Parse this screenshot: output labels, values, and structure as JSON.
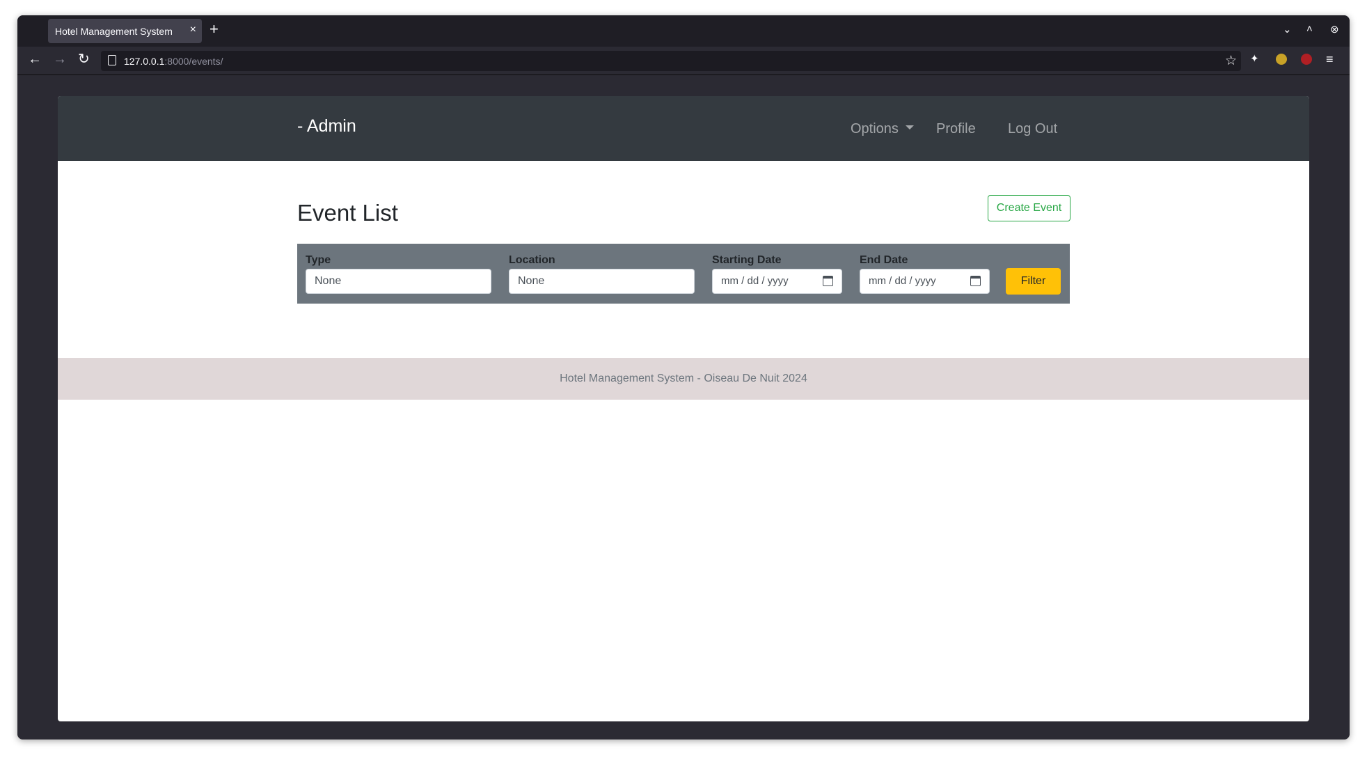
{
  "browser": {
    "tab_title": "Hotel Management System",
    "tab_close": "×",
    "new_tab": "+",
    "url_host": "127.0.0.1",
    "url_rest": ":8000/events/",
    "controls": {
      "list_all_tabs": "⌄",
      "maximize": "˄",
      "close": "⊗"
    }
  },
  "navbar": {
    "brand": "- Admin",
    "links": [
      {
        "label": "Options"
      },
      {
        "label": "Profile"
      },
      {
        "label": "Log Out"
      }
    ]
  },
  "main": {
    "title": "Event List",
    "create_button": "Create Event"
  },
  "filter": {
    "fields": [
      {
        "label": "Type",
        "value": "None"
      },
      {
        "label": "Location",
        "value": "None"
      },
      {
        "label": "Starting Date",
        "placeholder": "mm / dd / yyyy"
      },
      {
        "label": "End Date",
        "placeholder": "mm / dd / yyyy"
      }
    ],
    "button": "Filter"
  },
  "footer": {
    "text": "Hotel Management System - Oiseau De Nuit 2024"
  },
  "colors": {
    "navbar_bg": "#343a40",
    "filter_bg": "#6c757d",
    "filter_button": "#ffc107",
    "create_button": "#28a745",
    "footer_bg": "#e0d7d8"
  }
}
